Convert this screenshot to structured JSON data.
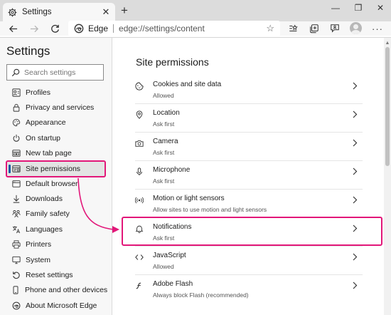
{
  "window": {
    "tab_title": "Settings",
    "tab_close": "✕",
    "new_tab": "+",
    "minimize": "—",
    "restore": "❐",
    "close": "✕"
  },
  "address_bar": {
    "brand": "Edge",
    "url": "edge://settings/content"
  },
  "sidebar": {
    "title": "Settings",
    "search_placeholder": "Search settings",
    "items": [
      {
        "label": "Profiles",
        "icon": "profile-icon"
      },
      {
        "label": "Privacy and services",
        "icon": "lock-icon"
      },
      {
        "label": "Appearance",
        "icon": "appearance-icon"
      },
      {
        "label": "On startup",
        "icon": "power-icon"
      },
      {
        "label": "New tab page",
        "icon": "new-tab-icon"
      },
      {
        "label": "Site permissions",
        "icon": "site-permissions-icon",
        "active": true
      },
      {
        "label": "Default browser",
        "icon": "browser-icon"
      },
      {
        "label": "Downloads",
        "icon": "download-icon"
      },
      {
        "label": "Family safety",
        "icon": "family-icon"
      },
      {
        "label": "Languages",
        "icon": "languages-icon"
      },
      {
        "label": "Printers",
        "icon": "printer-icon"
      },
      {
        "label": "System",
        "icon": "system-icon"
      },
      {
        "label": "Reset settings",
        "icon": "reset-icon"
      },
      {
        "label": "Phone and other devices",
        "icon": "phone-icon"
      },
      {
        "label": "About Microsoft Edge",
        "icon": "edge-icon"
      }
    ]
  },
  "main": {
    "title": "Site permissions",
    "permissions": [
      {
        "title": "Cookies and site data",
        "subtitle": "Allowed",
        "icon": "cookie-icon"
      },
      {
        "title": "Location",
        "subtitle": "Ask first",
        "icon": "location-icon"
      },
      {
        "title": "Camera",
        "subtitle": "Ask first",
        "icon": "camera-icon"
      },
      {
        "title": "Microphone",
        "subtitle": "Ask first",
        "icon": "microphone-icon"
      },
      {
        "title": "Motion or light sensors",
        "subtitle": "Allow sites to use motion and light sensors",
        "icon": "sensor-icon"
      },
      {
        "title": "Notifications",
        "subtitle": "Ask first",
        "icon": "bell-icon"
      },
      {
        "title": "JavaScript",
        "subtitle": "Allowed",
        "icon": "javascript-icon"
      },
      {
        "title": "Adobe Flash",
        "subtitle": "Always block Flash (recommended)",
        "icon": "flash-icon"
      }
    ]
  },
  "colors": {
    "highlight": "#e21779",
    "active_indicator": "#0c59a4",
    "sidebar_bg": "#f7f7f7",
    "titlebar_bg": "#dcdcdc"
  }
}
